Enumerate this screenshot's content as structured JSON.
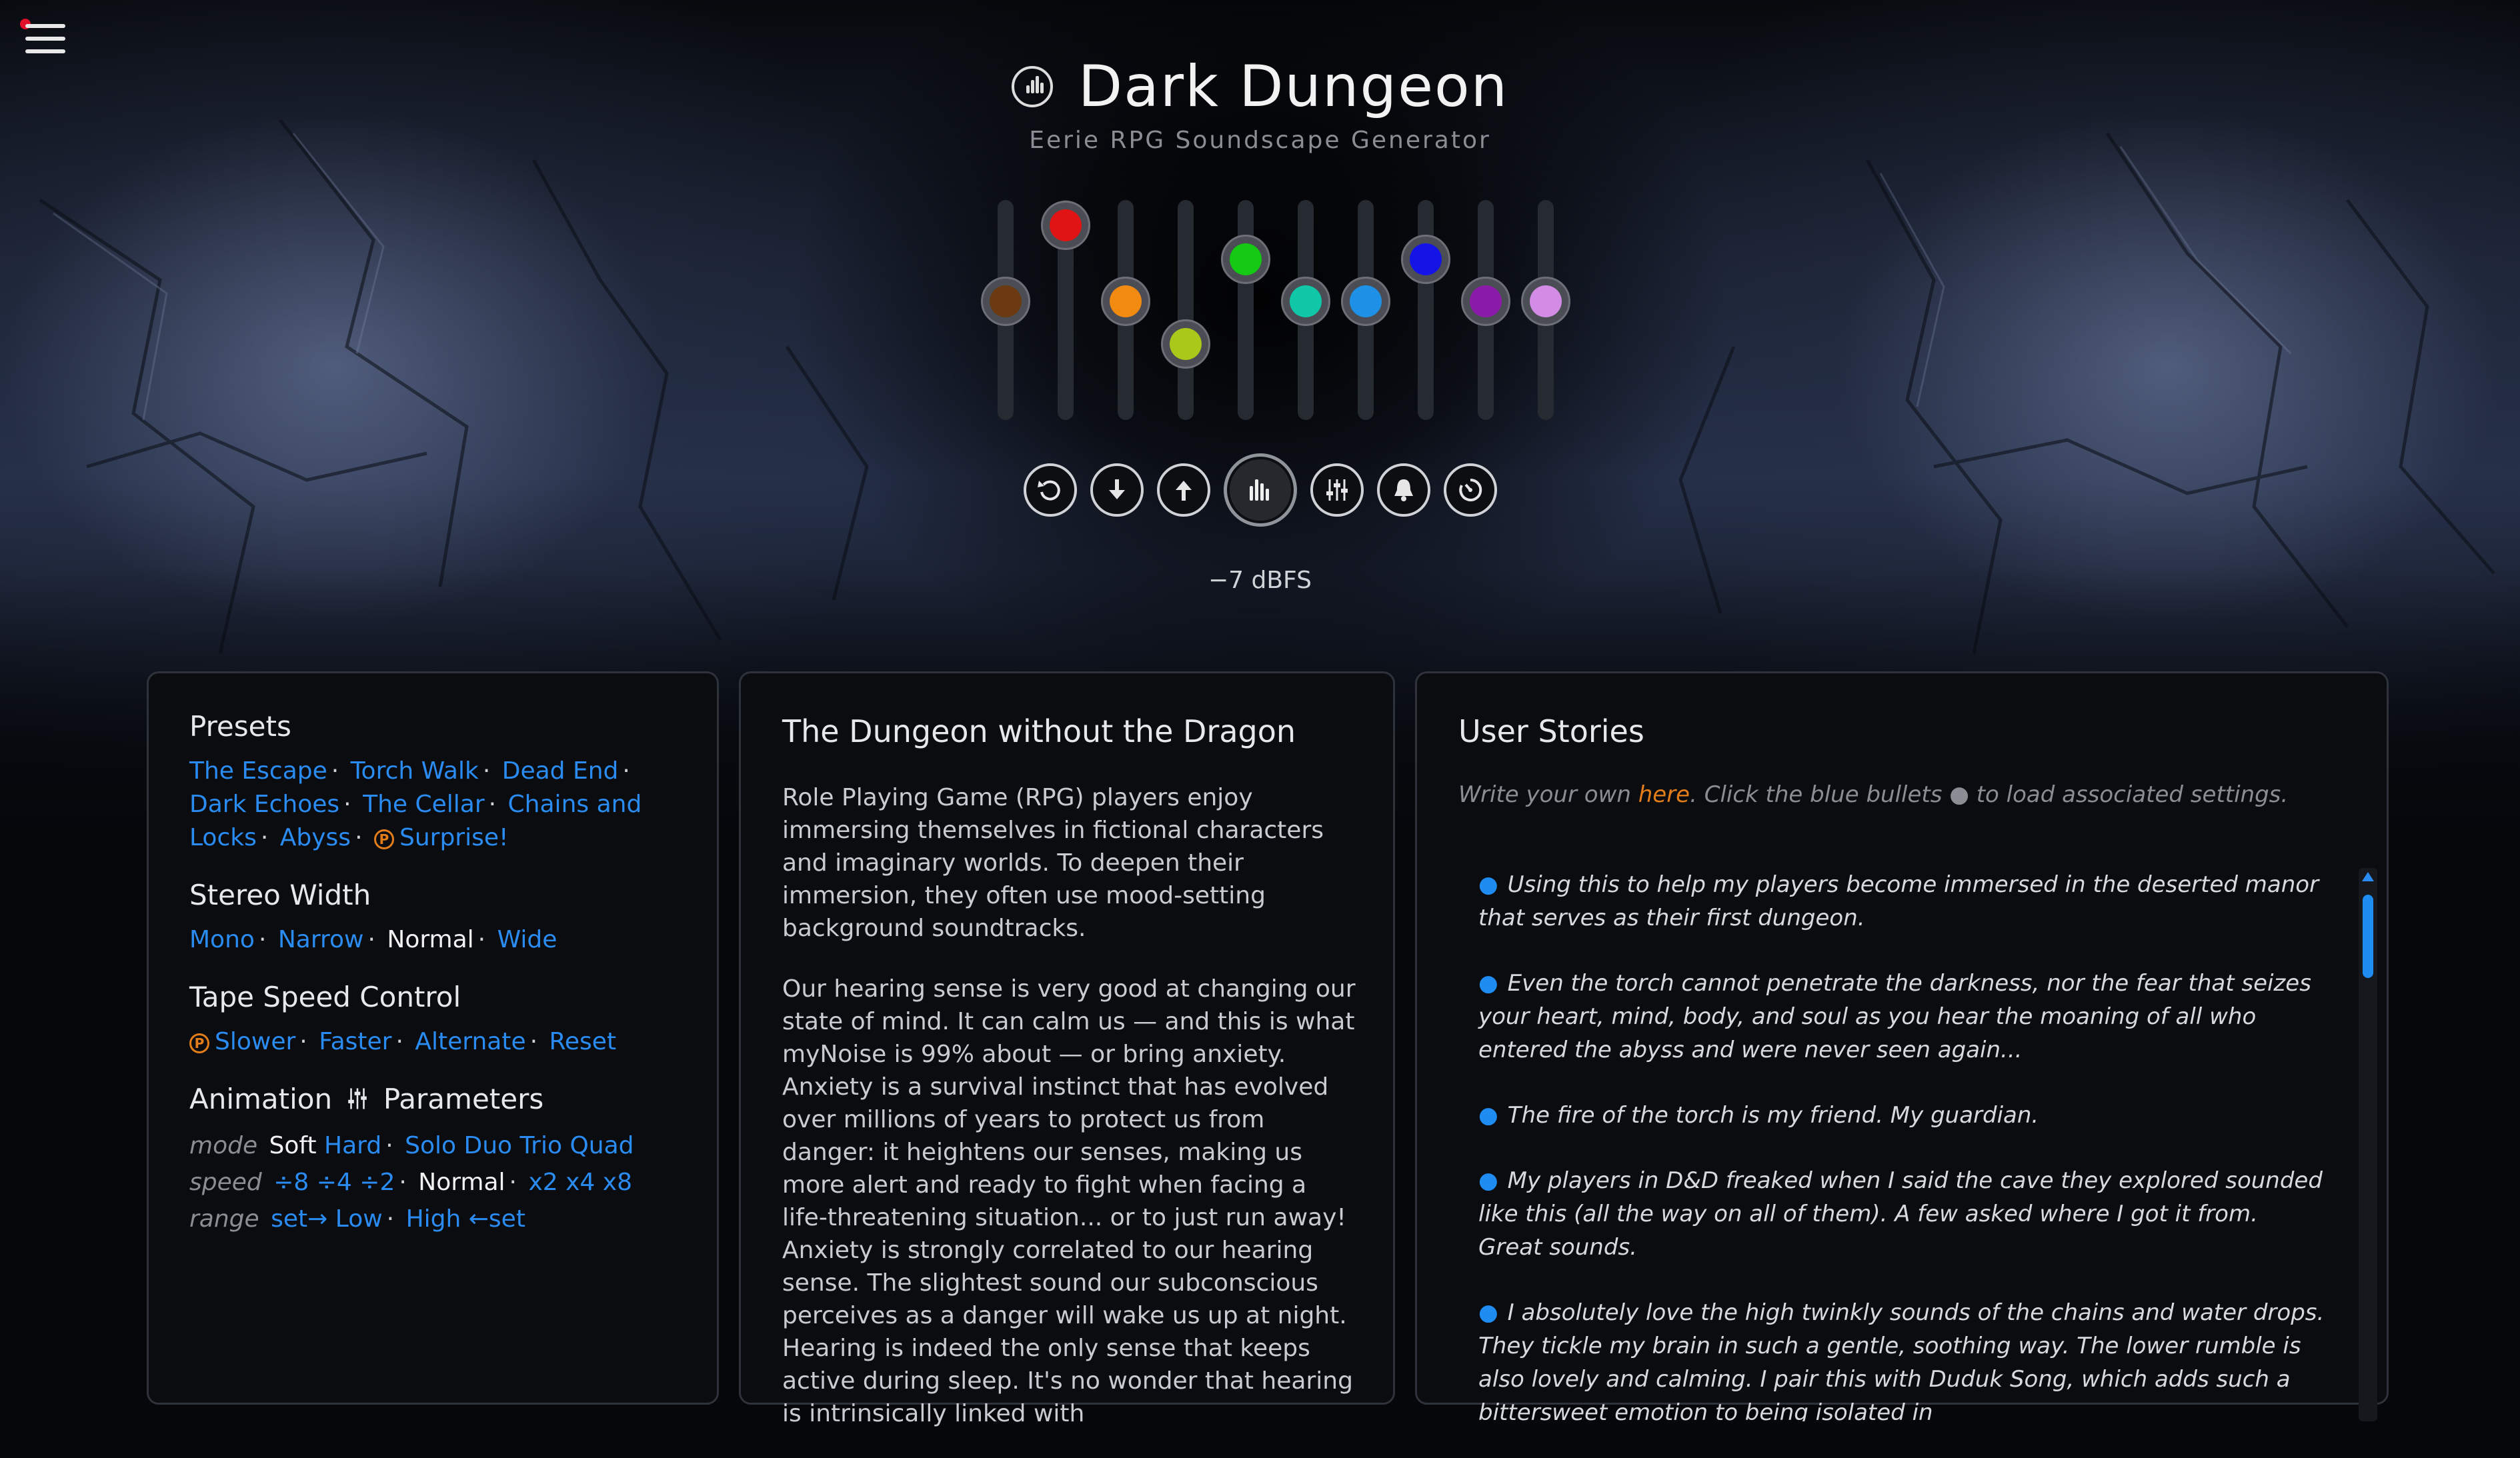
{
  "header": {
    "title": "Dark Dungeon",
    "subtitle": "Eerie RPG Soundscape Generator"
  },
  "mixer": {
    "sliders": [
      {
        "color": "#6b3a12",
        "level": 0.55
      },
      {
        "color": "#e01414",
        "level": 1.0
      },
      {
        "color": "#f08a10",
        "level": 0.55
      },
      {
        "color": "#a8c81a",
        "level": 0.3
      },
      {
        "color": "#14c814",
        "level": 0.8
      },
      {
        "color": "#10c8a8",
        "level": 0.55
      },
      {
        "color": "#1e90e6",
        "level": 0.55
      },
      {
        "color": "#1414e6",
        "level": 0.8
      },
      {
        "color": "#8a1aa8",
        "level": 0.55
      },
      {
        "color": "#d28ce6",
        "level": 0.55
      }
    ],
    "level_readout": "−7 dBFS",
    "icons": [
      "undo-icon",
      "download-icon",
      "upload-icon",
      "equalizer-icon",
      "sliders-icon",
      "bell-icon",
      "timer-icon"
    ]
  },
  "presets_panel": {
    "presets_heading": "Presets",
    "presets": [
      "The Escape",
      "Torch Walk",
      "Dead End",
      "Dark Echoes",
      "The Cellar",
      "Chains and Locks",
      "Abyss"
    ],
    "surprise": "Surprise!",
    "premium_mark": "P",
    "stereo_heading": "Stereo Width",
    "stereo_options": [
      "Mono",
      "Narrow",
      "Normal",
      "Wide"
    ],
    "stereo_selected": "Normal",
    "tape_heading": "Tape Speed Control",
    "tape_options": [
      "Slower",
      "Faster",
      "Alternate",
      "Reset"
    ],
    "anim_heading_pre": "Animation",
    "anim_heading_post": "Parameters",
    "mode_label": "mode",
    "mode_selected": "Soft",
    "mode_hard": "Hard",
    "mode_voices": [
      "Solo",
      "Duo",
      "Trio",
      "Quad"
    ],
    "speed_label": "speed",
    "speed_slow": [
      "÷8",
      "÷4",
      "÷2"
    ],
    "speed_normal": "Normal",
    "speed_fast": [
      "x2",
      "x4",
      "x8"
    ],
    "range_label": "range",
    "range_low": "set→ Low",
    "range_high": "High ←set"
  },
  "article": {
    "heading": "The Dungeon without the Dragon",
    "paragraphs": [
      "Role Playing Game (RPG) players enjoy immersing themselves in fictional characters and imaginary worlds. To deepen their immersion, they often use mood-setting background soundtracks.",
      "Our hearing sense is very good at changing our state of mind. It can calm us — and this is what myNoise is 99% about — or bring anxiety. Anxiety is a survival instinct that has evolved over millions of years to protect us from danger: it heightens our senses, making us more alert and ready to fight when facing a life-threatening situation... or to just run away! Anxiety is strongly correlated to our hearing sense. The slightest sound our subconscious perceives as a danger will wake us up at night. Hearing is indeed the only sense that keeps active during sleep. It's no wonder that hearing is intrinsically linked with"
    ]
  },
  "stories_panel": {
    "heading": "User Stories",
    "intro_pre": "Write your own ",
    "intro_link": "here",
    "intro_post": ". Click the blue bullets ● to load associated settings.",
    "bullet": "●",
    "stories": [
      "Using this to help my players become immersed in the deserted manor that serves as their first dungeon.",
      "Even the torch cannot penetrate the darkness, nor the fear that seizes your heart, mind, body, and soul as you hear the moaning of all who entered the abyss and were never seen again...",
      "The fire of the torch is my friend. My guardian.",
      "My players in D&D freaked when I said the cave they explored sounded like this (all the way on all of them). A few asked where I got it from. Great sounds.",
      "I absolutely love the high twinkly sounds of the chains and water drops. They tickle my brain in such a gentle, soothing way. The lower rumble is also lovely and calming. I pair this with Duduk Song, which adds such a bittersweet emotion to being isolated in"
    ]
  }
}
